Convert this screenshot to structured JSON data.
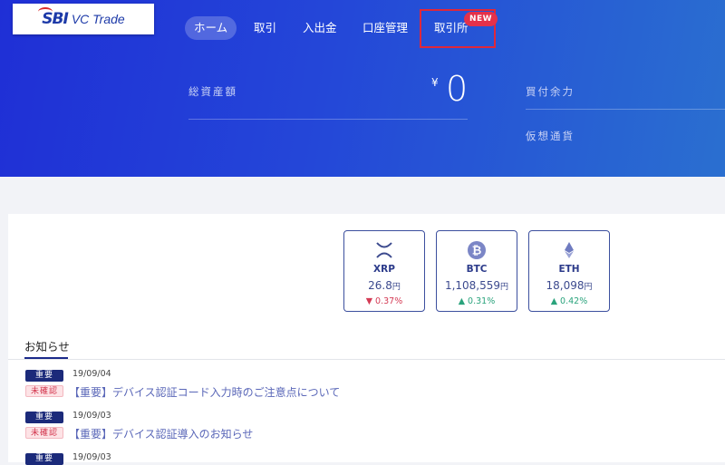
{
  "logo": {
    "brand": "SBI",
    "product": "VC Trade"
  },
  "nav": {
    "items": [
      {
        "label": "ホーム",
        "active": true
      },
      {
        "label": "取引"
      },
      {
        "label": "入出金"
      },
      {
        "label": "口座管理"
      },
      {
        "label": "取引所"
      }
    ],
    "new_badge": "NEW"
  },
  "summary": {
    "total_assets_label": "総資産額",
    "currency_symbol": "¥",
    "total_assets_value": "0",
    "buying_power_label": "買付余力",
    "crypto_label": "仮想通貨"
  },
  "coins": [
    {
      "symbol": "XRP",
      "price": "26.8",
      "unit": "円",
      "change": "▼ 0.37%",
      "direction": "down",
      "icon": "xrp-icon"
    },
    {
      "symbol": "BTC",
      "price": "1,108,559",
      "unit": "円",
      "change": "▲ 0.31%",
      "direction": "up",
      "icon": "bitcoin-icon"
    },
    {
      "symbol": "ETH",
      "price": "18,098",
      "unit": "円",
      "change": "▲ 0.42%",
      "direction": "up",
      "icon": "ethereum-icon"
    }
  ],
  "news": {
    "title": "お知らせ",
    "items": [
      {
        "badge": "重要",
        "date": "19/09/04",
        "status": "未確認",
        "text": "【重要】デバイス認証コード入力時のご注意点について"
      },
      {
        "badge": "重要",
        "date": "19/09/03",
        "status": "未確認",
        "text": "【重要】デバイス認証導入のお知らせ"
      },
      {
        "badge": "重要",
        "date": "19/09/03"
      }
    ]
  },
  "colors": {
    "header_gradient_start": "#1f2fd6",
    "header_gradient_end": "#2a6fd0",
    "accent_red": "#e0273a",
    "navy": "#1b2a7a"
  }
}
